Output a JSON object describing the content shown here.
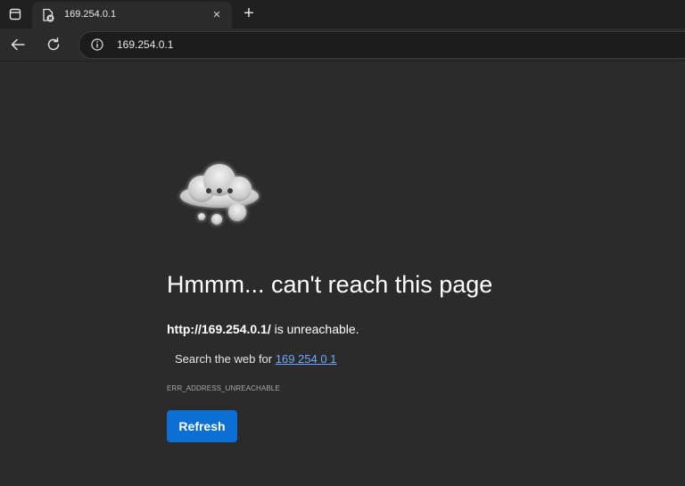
{
  "tab": {
    "title": "169.254.0.1",
    "close": "×"
  },
  "new_tab": "+",
  "address": {
    "url": "169.254.0.1"
  },
  "error": {
    "heading": "Hmmm... can't reach this page",
    "url_bold": "http://169.254.0.1/",
    "unreachable_suffix": " is unreachable.",
    "search_prefix": "Search the web for ",
    "search_link": "169 254 0 1",
    "code": "ERR_ADDRESS_UNREACHABLE",
    "refresh_label": "Refresh"
  },
  "colors": {
    "background": "#2b2b2b",
    "tabstrip": "#202020",
    "accent": "#0b6fd6",
    "link": "#6fa8ff"
  },
  "icons": [
    "tab-actions-icon",
    "page-error-favicon",
    "close-icon",
    "plus-icon",
    "back-arrow-icon",
    "refresh-icon",
    "info-icon",
    "thinking-cloud-icon"
  ]
}
